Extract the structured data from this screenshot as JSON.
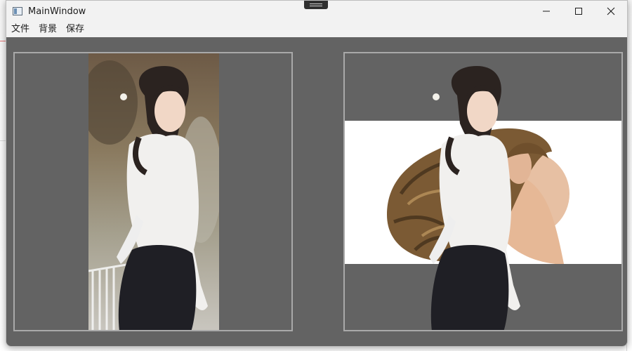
{
  "window": {
    "title": "MainWindow",
    "controls": {
      "minimize_icon": "minimize-icon",
      "maximize_icon": "maximize-icon",
      "close_icon": "close-icon"
    }
  },
  "menu": {
    "items": [
      {
        "label": "文件"
      },
      {
        "label": "背景"
      },
      {
        "label": "保存"
      }
    ]
  },
  "panels": {
    "left": {
      "content": "original photo of woman in white blouse"
    },
    "right": {
      "content": "composited photo with new white background"
    }
  },
  "colors": {
    "workspace": "#636363",
    "panel_border": "#a9a9a9",
    "titlebar": "#f2f2f2",
    "composite_background": "#ffffff"
  }
}
